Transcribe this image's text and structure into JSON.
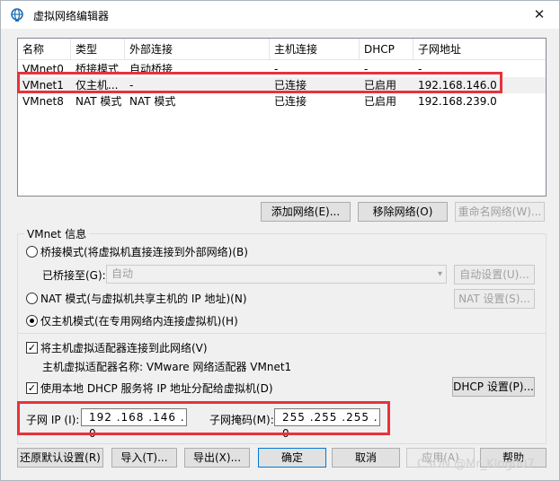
{
  "window": {
    "title": "虚拟网络编辑器",
    "close_glyph": "✕"
  },
  "table": {
    "columns": [
      "名称",
      "类型",
      "外部连接",
      "主机连接",
      "DHCP",
      "子网地址"
    ],
    "rows": [
      [
        "VMnet0",
        "桥接模式",
        "自动桥接",
        "-",
        "-",
        "-"
      ],
      [
        "VMnet1",
        "仅主机...",
        "-",
        "已连接",
        "已启用",
        "192.168.146.0"
      ],
      [
        "VMnet8",
        "NAT 模式",
        "NAT 模式",
        "已连接",
        "已启用",
        "192.168.239.0"
      ]
    ],
    "selected_row": 1
  },
  "list_buttons": {
    "add": "添加网络(E)...",
    "remove": "移除网络(O)",
    "rename": "重命名网络(W)..."
  },
  "vmnet_info": {
    "group_label": "VMnet 信息",
    "bridge_radio": "桥接模式(将虚拟机直接连接到外部网络)(B)",
    "bridged_to_label": "已桥接至(G):",
    "bridged_to_value": "自动",
    "auto_settings": "自动设置(U)...",
    "nat_radio": "NAT 模式(与虚拟机共享主机的 IP 地址)(N)",
    "nat_settings": "NAT 设置(S)...",
    "hostonly_radio": "仅主机模式(在专用网络内连接虚拟机)(H)",
    "connect_adapter_check": "将主机虚拟适配器连接到此网络(V)",
    "adapter_name_line": "主机虚拟适配器名称: VMware 网络适配器 VMnet1",
    "dhcp_check": "使用本地 DHCP 服务将 IP 地址分配给虚拟机(D)",
    "dhcp_settings": "DHCP 设置(P)...",
    "subnet_ip_label": "子网 IP (I):",
    "subnet_ip_value": "192 .168 .146 . 0",
    "subnet_mask_label": "子网掩码(M):",
    "subnet_mask_value": "255 .255 .255 . 0"
  },
  "bottom_buttons": {
    "restore": "还原默认设置(R)",
    "import": "导入(T)...",
    "export": "导出(X)...",
    "ok": "确定",
    "cancel": "取消",
    "apply": "应用(A)",
    "help": "帮助"
  },
  "watermark": "CSDN @Mr_King007",
  "colors": {
    "highlight_red": "#e8323a",
    "accent_blue": "#0078d7"
  }
}
